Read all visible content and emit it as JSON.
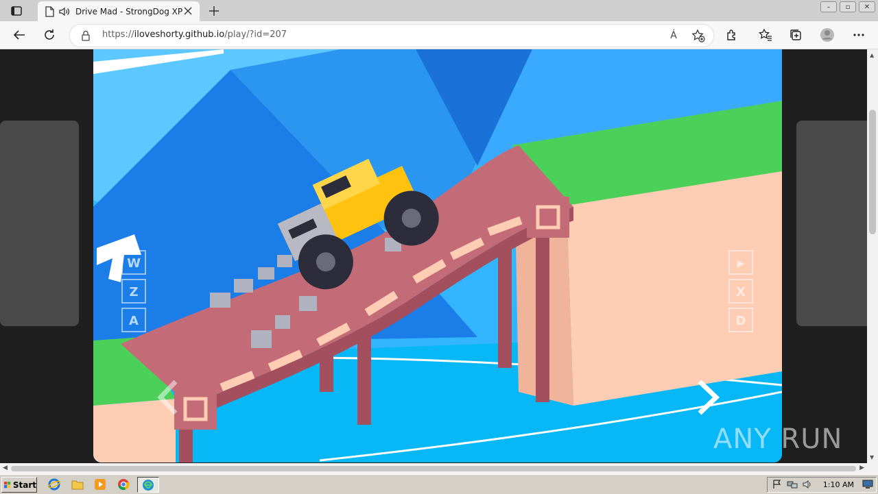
{
  "browser": {
    "tab": {
      "title": "Drive Mad - StrongDog XP"
    },
    "address": {
      "protocol": "https://",
      "host": "iloveshorty.github.io",
      "path": "/play/?id=207"
    },
    "read_aloud_label": "Á"
  },
  "game": {
    "left_controls": [
      "W",
      "Z",
      "A"
    ],
    "right_controls": [
      "▶",
      "X",
      "D"
    ],
    "colors": {
      "sky": "#33b6ff",
      "mountain_dark": "#1a7de8",
      "grass": "#4bd15a",
      "cliff": "#ffcdb4",
      "bridge": "#c46b78",
      "truck": "#ffc20e"
    }
  },
  "watermark": {
    "text": "ANY RUN"
  },
  "taskbar": {
    "start_label": "Start",
    "clock": "1:10 AM"
  },
  "icons": [
    "tab-actions-icon",
    "page-icon",
    "speaker-icon",
    "close-icon",
    "plus-icon",
    "back-icon",
    "refresh-icon",
    "lock-icon",
    "favorite-add-icon",
    "extensions-icon",
    "favorites-icon",
    "collections-icon",
    "profile-icon",
    "more-icon",
    "ie-icon",
    "folder-icon",
    "media-player-icon",
    "chrome-icon",
    "edge-icon",
    "flag-icon",
    "network-icon",
    "volume-icon",
    "monitor-icon"
  ]
}
